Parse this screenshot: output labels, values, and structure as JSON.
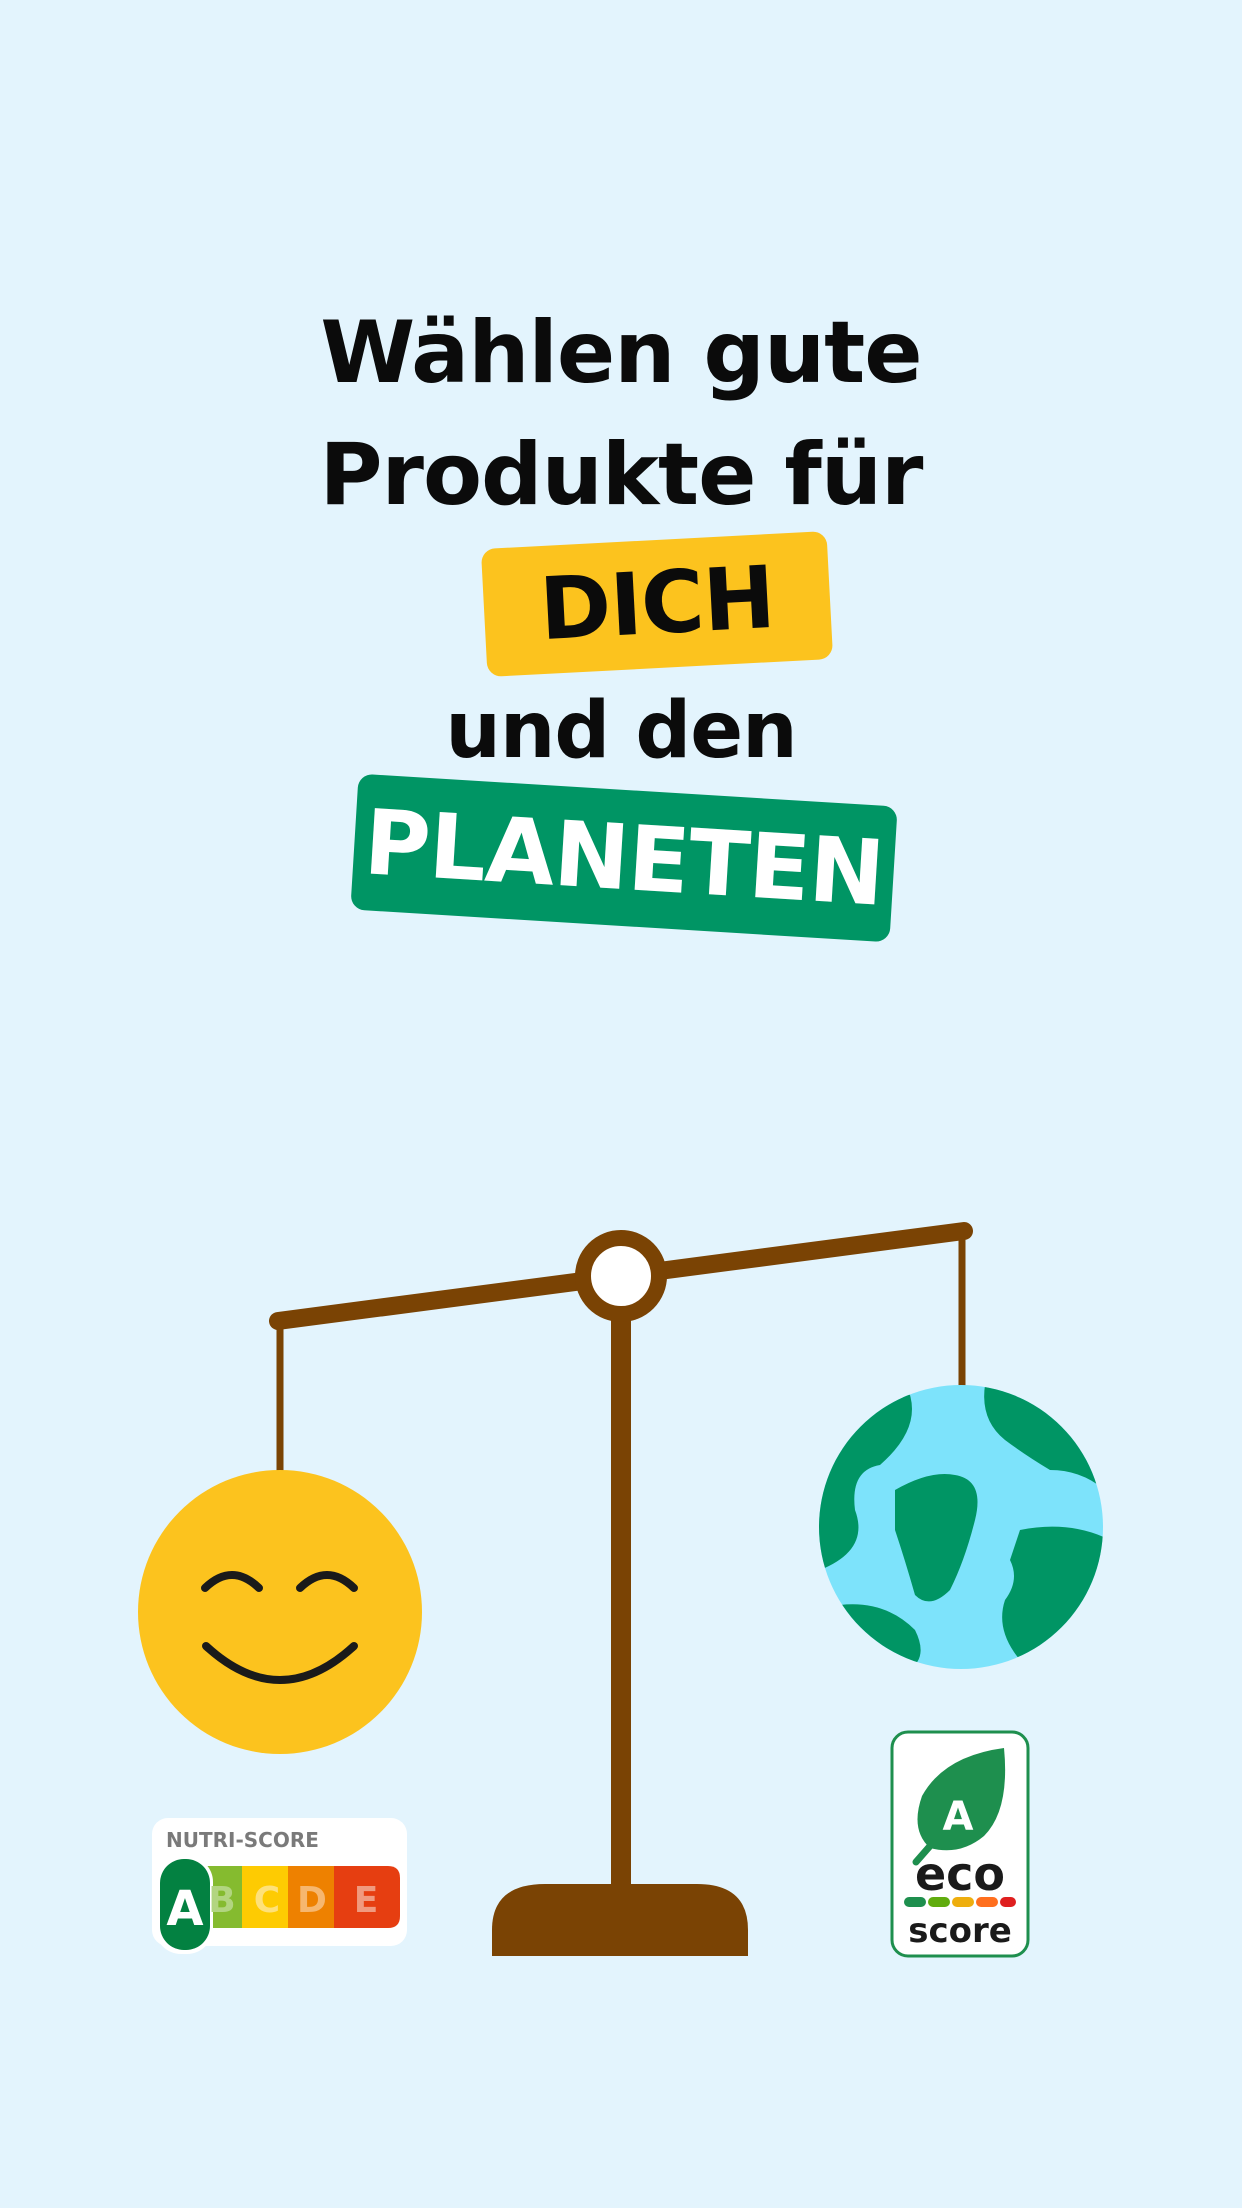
{
  "headline": {
    "line1": "Wählen gute",
    "line2": "Produkte für",
    "highlight_you": "DICH",
    "line4": "und den",
    "highlight_planet": "PLANETEN"
  },
  "nutri_score": {
    "title": "NUTRI-SCORE",
    "grades": [
      "A",
      "B",
      "C",
      "D",
      "E"
    ],
    "selected": "A",
    "colors": [
      "#038141",
      "#85bb2f",
      "#fecb02",
      "#ee8100",
      "#e63e11"
    ]
  },
  "eco_score": {
    "grade": "A",
    "word1": "eco",
    "word2": "score",
    "colors": [
      "#1e8f4e",
      "#60ac0e",
      "#eeae0e",
      "#ff6f1e",
      "#df1f1f"
    ]
  },
  "colors": {
    "background": "#e3f4fd",
    "yellow": "#fcc31e",
    "green": "#009564",
    "scale_brown": "#7a4304",
    "earth_water": "#7de3fb"
  },
  "icons": {
    "scale": "balance-scale-icon",
    "smiley": "smiley-face-icon",
    "earth": "globe-icon"
  }
}
